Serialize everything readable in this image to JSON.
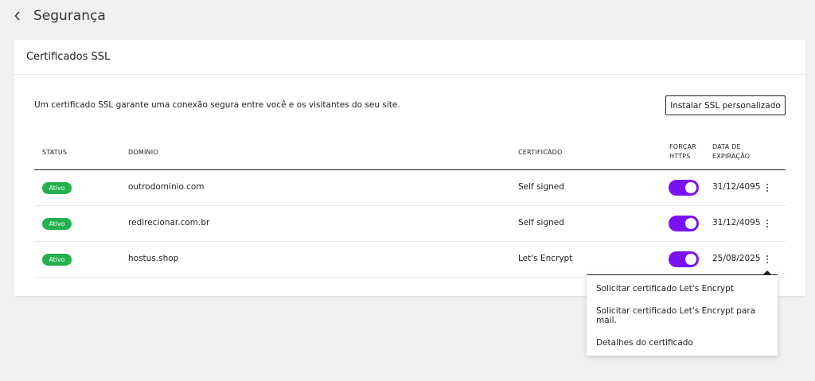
{
  "header": {
    "title": "Segurança",
    "back_icon": "chevron-left-icon"
  },
  "card": {
    "title": "Certificados SSL",
    "intro": "Um certificado SSL garante uma conexão segura entre você e os visitantes do seu site.",
    "install_button": "Instalar SSL personalizado"
  },
  "table": {
    "headers": {
      "status": "STATUS",
      "domain": "DOMÍNIO",
      "certificate": "CERTIFICADO",
      "force_https": "FORÇAR HTTPS",
      "expiration": "DATA DE EXPIRAÇÃO"
    },
    "rows": [
      {
        "status": "Ativo",
        "domain": "outrodominio.com",
        "certificate": "Self signed",
        "force_https": true,
        "expiration": "31/12/4095"
      },
      {
        "status": "Ativo",
        "domain": "redirecionar.com.br",
        "certificate": "Self signed",
        "force_https": true,
        "expiration": "31/12/4095"
      },
      {
        "status": "Ativo",
        "domain": "hostus.shop",
        "certificate": "Let's Encrypt",
        "force_https": true,
        "expiration": "25/08/2025"
      }
    ]
  },
  "menu": {
    "items": [
      {
        "label": "Solicitar certificado Let's Encrypt"
      },
      {
        "label": "Solicitar certificado Let's Encrypt para mail."
      },
      {
        "label": "Detalhes do certificado"
      }
    ]
  },
  "colors": {
    "badge": "#22b14c",
    "toggle": "#7b11f2",
    "background": "#f1f1f1"
  }
}
